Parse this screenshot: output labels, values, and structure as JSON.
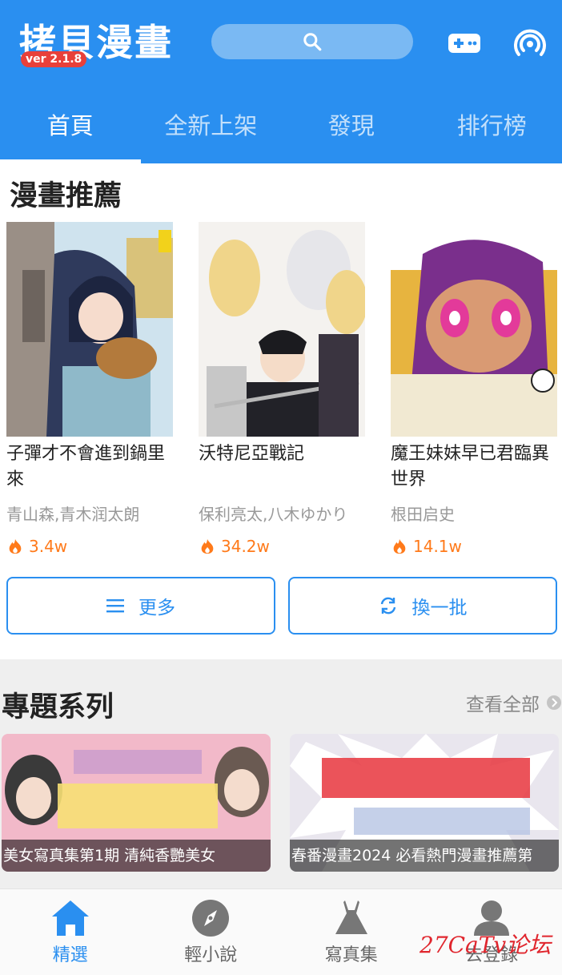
{
  "header": {
    "logo": "拷貝漫畫",
    "version": "ver 2.1.8",
    "tabs": [
      {
        "label": "首頁",
        "active": true
      },
      {
        "label": "全新上架",
        "active": false
      },
      {
        "label": "發現",
        "active": false
      },
      {
        "label": "排行榜",
        "active": false
      }
    ]
  },
  "recommend": {
    "title": "漫畫推薦",
    "cards": [
      {
        "title": "子彈才不會進到鍋里來",
        "author": "青山森,青木润太朗",
        "heat": "3.4w"
      },
      {
        "title": "沃特尼亞戰記",
        "author": "保利亮太,八木ゆかり",
        "heat": "34.2w"
      },
      {
        "title": "魔王妹妹早已君臨異世界",
        "author": "根田启史",
        "heat": "14.1w"
      }
    ],
    "more_label": "更多",
    "refresh_label": "換一批"
  },
  "topics": {
    "title": "專題系列",
    "see_all": "查看全部",
    "items": [
      {
        "caption": "美女寫真集第1期 清純香艷美女"
      },
      {
        "caption": "春番漫畫2024 必看熱門漫畫推薦第"
      }
    ]
  },
  "bottom_nav": [
    {
      "label": "精選",
      "icon": "home-icon",
      "active": true
    },
    {
      "label": "輕小說",
      "icon": "compass-icon",
      "active": false
    },
    {
      "label": "寫真集",
      "icon": "dress-icon",
      "active": false
    },
    {
      "label": "去登錄",
      "icon": "user-icon",
      "active": false
    }
  ],
  "watermark": "27CaTv论坛",
  "colors": {
    "primary": "#2a8ff0",
    "heat": "#ff7a1a",
    "version_badge": "#e8403a"
  }
}
